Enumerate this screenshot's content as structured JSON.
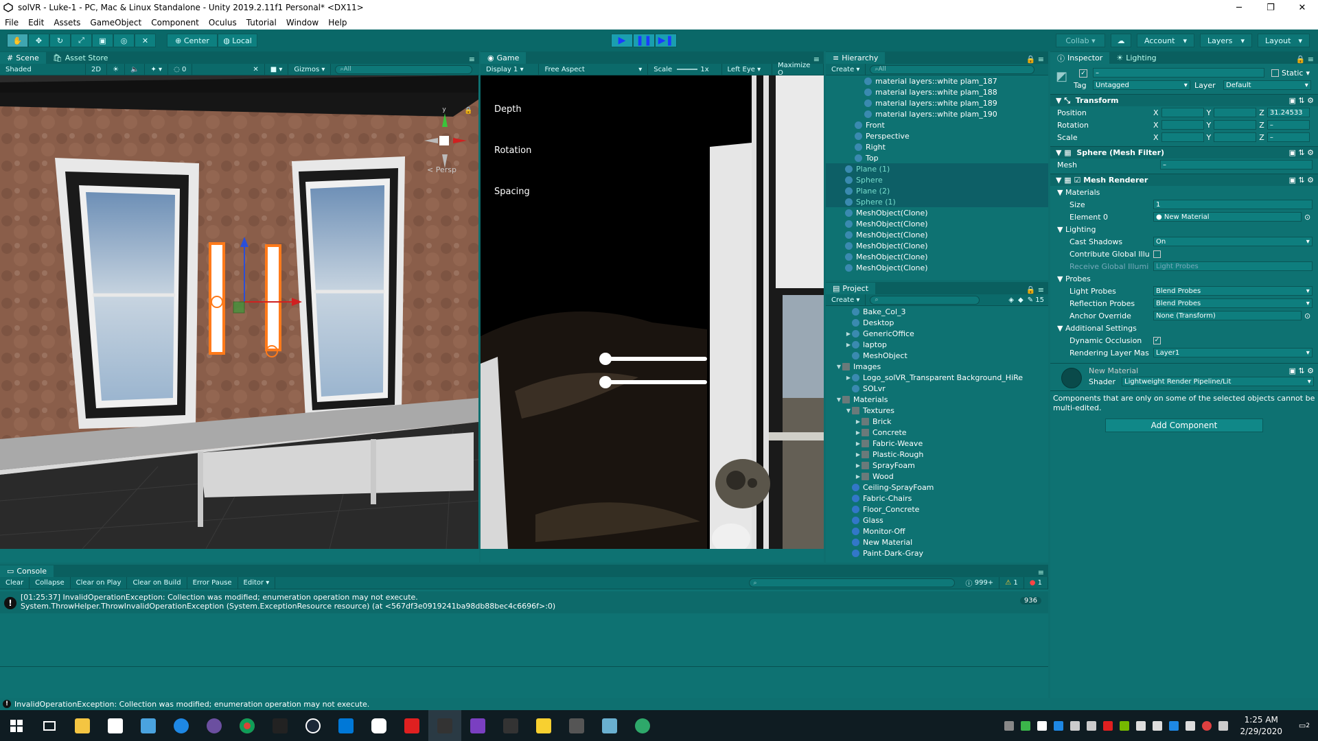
{
  "window": {
    "title": "solVR - Luke-1 - PC, Mac & Linux Standalone - Unity 2019.2.11f1 Personal* <DX11>",
    "minimize": "─",
    "maximize": "❐",
    "close": "✕"
  },
  "menu": [
    "File",
    "Edit",
    "Assets",
    "GameObject",
    "Component",
    "Oculus",
    "Tutorial",
    "Window",
    "Help"
  ],
  "toolbar": {
    "pivot": "Center",
    "space": "Local",
    "collab": "Collab ▾",
    "account": "Account",
    "layers": "Layers",
    "layout": "Layout"
  },
  "scene": {
    "tab_scene": "Scene",
    "tab_asset_store": "Asset Store",
    "shading_mode": "Shaded",
    "mode_2d": "2D",
    "hidden_count": "0",
    "gizmos": "Gizmos",
    "search_placeholder": "All",
    "persp_label": "Persp",
    "gizmo_y": "y"
  },
  "game": {
    "tab": "Game",
    "display": "Display 1",
    "aspect": "Free Aspect",
    "scale_label": "Scale",
    "scale_value": "1x",
    "eye": "Left Eye",
    "maximize": "Maximize O",
    "labels": [
      "Depth",
      "Rotation",
      "Spacing"
    ],
    "sliders": [
      0.0,
      0.0
    ]
  },
  "hierarchy": {
    "tab": "Hierarchy",
    "create": "Create",
    "search_placeholder": "All",
    "items": [
      {
        "label": "material layers::white plam_187",
        "indent": 4,
        "state": "normal"
      },
      {
        "label": "material layers::white plam_188",
        "indent": 4,
        "state": "normal"
      },
      {
        "label": "material layers::white plam_189",
        "indent": 4,
        "state": "normal"
      },
      {
        "label": "material layers::white plam_190",
        "indent": 4,
        "state": "normal"
      },
      {
        "label": "Front",
        "indent": 3,
        "state": "normal"
      },
      {
        "label": "Perspective",
        "indent": 3,
        "state": "normal"
      },
      {
        "label": "Right",
        "indent": 3,
        "state": "normal"
      },
      {
        "label": "Top",
        "indent": 3,
        "state": "normal"
      },
      {
        "label": "Plane (1)",
        "indent": 2,
        "state": "selected"
      },
      {
        "label": "Sphere",
        "indent": 2,
        "state": "selected"
      },
      {
        "label": "Plane (2)",
        "indent": 2,
        "state": "selected"
      },
      {
        "label": "Sphere (1)",
        "indent": 2,
        "state": "selected"
      },
      {
        "label": "MeshObject(Clone)",
        "indent": 2,
        "state": "normal"
      },
      {
        "label": "MeshObject(Clone)",
        "indent": 2,
        "state": "normal"
      },
      {
        "label": "MeshObject(Clone)",
        "indent": 2,
        "state": "normal"
      },
      {
        "label": "MeshObject(Clone)",
        "indent": 2,
        "state": "normal"
      },
      {
        "label": "MeshObject(Clone)",
        "indent": 2,
        "state": "normal"
      },
      {
        "label": "MeshObject(Clone)",
        "indent": 2,
        "state": "normal"
      }
    ]
  },
  "project": {
    "tab": "Project",
    "create": "Create",
    "hidden_count": "15",
    "items": [
      {
        "label": "Bake_Col_3",
        "indent": 2,
        "icon": "go",
        "arrow": ""
      },
      {
        "label": "Desktop",
        "indent": 2,
        "icon": "go",
        "arrow": ""
      },
      {
        "label": "GenericOffice",
        "indent": 2,
        "icon": "go",
        "arrow": "▶"
      },
      {
        "label": "laptop",
        "indent": 2,
        "icon": "go",
        "arrow": "▶"
      },
      {
        "label": "MeshObject",
        "indent": 2,
        "icon": "go",
        "arrow": ""
      },
      {
        "label": "Images",
        "indent": 1,
        "icon": "folder",
        "arrow": "▼"
      },
      {
        "label": "Logo_solVR_Transparent Background_HiRe",
        "indent": 2,
        "icon": "go",
        "arrow": "▶"
      },
      {
        "label": "SOLvr",
        "indent": 2,
        "icon": "go",
        "arrow": ""
      },
      {
        "label": "Materials",
        "indent": 1,
        "icon": "folder",
        "arrow": "▼"
      },
      {
        "label": "Textures",
        "indent": 2,
        "icon": "folder",
        "arrow": "▼"
      },
      {
        "label": "Brick",
        "indent": 3,
        "icon": "folder",
        "arrow": "▶"
      },
      {
        "label": "Concrete",
        "indent": 3,
        "icon": "folder",
        "arrow": "▶"
      },
      {
        "label": "Fabric-Weave",
        "indent": 3,
        "icon": "folder",
        "arrow": "▶"
      },
      {
        "label": "Plastic-Rough",
        "indent": 3,
        "icon": "folder",
        "arrow": "▶"
      },
      {
        "label": "SprayFoam",
        "indent": 3,
        "icon": "folder",
        "arrow": "▶"
      },
      {
        "label": "Wood",
        "indent": 3,
        "icon": "folder",
        "arrow": "▶"
      },
      {
        "label": "Ceiling-SprayFoam",
        "indent": 2,
        "icon": "sphere",
        "arrow": ""
      },
      {
        "label": "Fabric-Chairs",
        "indent": 2,
        "icon": "sphere",
        "arrow": ""
      },
      {
        "label": "Floor_Concrete",
        "indent": 2,
        "icon": "sphere",
        "arrow": ""
      },
      {
        "label": "Glass",
        "indent": 2,
        "icon": "sphere",
        "arrow": ""
      },
      {
        "label": "Monitor-Off",
        "indent": 2,
        "icon": "sphere",
        "arrow": ""
      },
      {
        "label": "New Material",
        "indent": 2,
        "icon": "sphere",
        "arrow": ""
      },
      {
        "label": "Paint-Dark-Gray",
        "indent": 2,
        "icon": "sphere",
        "arrow": ""
      }
    ]
  },
  "inspector": {
    "tab_inspector": "Inspector",
    "tab_lighting": "Lighting",
    "static_label": "Static",
    "tag_label": "Tag",
    "tag_value": "Untagged",
    "layer_label": "Layer",
    "layer_value": "Default",
    "transform": {
      "title": "Transform",
      "position_label": "Position",
      "rotation_label": "Rotation",
      "scale_label": "Scale",
      "position_z": "31.24533",
      "x": "X",
      "y": "Y",
      "z": "Z",
      "mixed": "–"
    },
    "mesh_filter": {
      "title": "Sphere (Mesh Filter)",
      "mesh_label": "Mesh",
      "mesh_value": "–"
    },
    "mesh_renderer": {
      "title": "Mesh Renderer",
      "materials": "Materials",
      "size_label": "Size",
      "size_value": "1",
      "element0_label": "Element 0",
      "element0_value": "New Material",
      "lighting": "Lighting",
      "cast_shadows_label": "Cast Shadows",
      "cast_shadows_value": "On",
      "contribute_gi_label": "Contribute Global Illu",
      "receive_gi_label": "Receive Global Illumi",
      "receive_gi_value": "Light Probes",
      "probes": "Probes",
      "light_probes_label": "Light Probes",
      "light_probes_value": "Blend Probes",
      "reflection_probes_label": "Reflection Probes",
      "reflection_probes_value": "Blend Probes",
      "anchor_override_label": "Anchor Override",
      "anchor_override_value": "None (Transform)",
      "additional": "Additional Settings",
      "dynamic_occlusion_label": "Dynamic Occlusion",
      "rendering_layer_label": "Rendering Layer Mas",
      "rendering_layer_value": "Layer1"
    },
    "material": {
      "name": "New Material",
      "shader_label": "Shader",
      "shader_value": "Lightweight Render Pipeline/Lit"
    },
    "note": "Components that are only on some of the selected objects cannot be multi-edited.",
    "add_component": "Add Component"
  },
  "console": {
    "tab": "Console",
    "buttons": [
      "Clear",
      "Collapse",
      "Clear on Play",
      "Clear on Build",
      "Error Pause",
      "Editor ▾"
    ],
    "log_count": "999+",
    "warn_count": "1",
    "error_count": "1",
    "entry_line1": "[01:25:37] InvalidOperationException: Collection was modified; enumeration operation may not execute.",
    "entry_line2": "System.ThrowHelper.ThrowInvalidOperationException (System.ExceptionResource resource) (at <567df3e0919241ba98db88bec4c6696f>:0)",
    "entry_count": "936"
  },
  "status": {
    "message": "InvalidOperationException: Collection was modified; enumeration operation may not execute."
  },
  "taskbar": {
    "time": "1:25 AM",
    "date": "2/29/2020",
    "notifications": "2"
  },
  "colors": {
    "theme": "#0e7272",
    "selection": "#0d5f66",
    "play_accent": "#1b3cff"
  }
}
